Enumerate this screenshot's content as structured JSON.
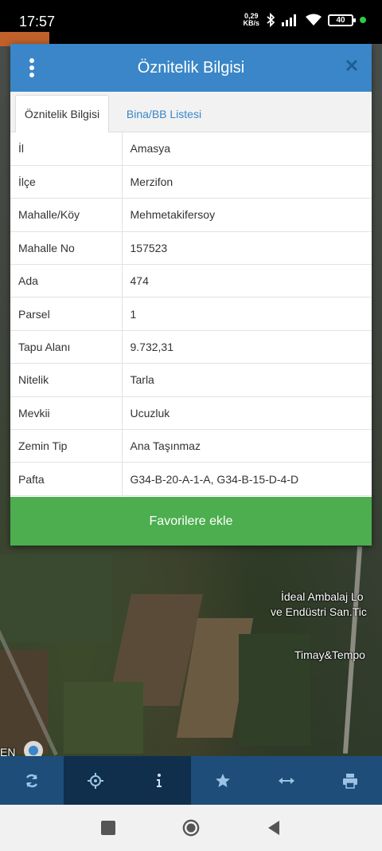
{
  "status": {
    "time": "17:57",
    "net_speed_value": "0,29",
    "net_speed_unit": "KB/s",
    "battery": "40"
  },
  "map": {
    "labels": [
      "İdeal Ambalaj Lo",
      "ve Endüstri San.Tic",
      "Timay&Tempo",
      "EN"
    ]
  },
  "dialog": {
    "title": "Öznitelik Bilgisi",
    "tabs": [
      {
        "label": "Öznitelik Bilgisi",
        "active": true
      },
      {
        "label": "Bina/BB Listesi",
        "active": false
      }
    ],
    "rows": [
      {
        "key": "İl",
        "value": "Amasya"
      },
      {
        "key": "İlçe",
        "value": "Merzifon"
      },
      {
        "key": "Mahalle/Köy",
        "value": "Mehmetakifersoy"
      },
      {
        "key": "Mahalle No",
        "value": "157523"
      },
      {
        "key": "Ada",
        "value": "474"
      },
      {
        "key": "Parsel",
        "value": "1"
      },
      {
        "key": "Tapu Alanı",
        "value": "9.732,31"
      },
      {
        "key": "Nitelik",
        "value": "Tarla"
      },
      {
        "key": "Mevkii",
        "value": "Ucuzluk"
      },
      {
        "key": "Zemin Tip",
        "value": "Ana Taşınmaz"
      },
      {
        "key": "Pafta",
        "value": "G34-B-20-A-1-A, G34-B-15-D-4-D"
      }
    ],
    "favorite_button": "Favorilere ekle"
  },
  "toolbar": {
    "tools": [
      "refresh-icon",
      "locate-icon",
      "info-icon",
      "star-icon",
      "measure-icon",
      "print-icon"
    ],
    "active": "info-icon"
  },
  "colors": {
    "header": "#3a86c8",
    "favorite": "#4cae4f",
    "toolbar": "#1d4d78",
    "toolbar_active": "#0f2f4d"
  }
}
